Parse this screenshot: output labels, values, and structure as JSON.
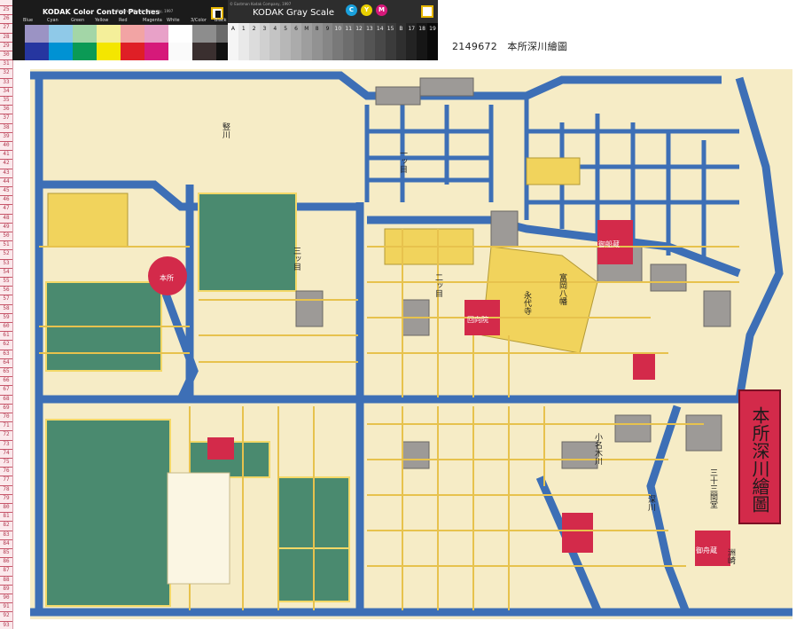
{
  "catalog_label": "2149672　本所深川繪圖",
  "map_title": "本所深川繪圖",
  "ruler": {
    "numbers": [
      "25",
      "26",
      "27",
      "28",
      "29",
      "30",
      "31",
      "32",
      "33",
      "34",
      "35",
      "36",
      "37",
      "38",
      "39",
      "40",
      "41",
      "42",
      "43",
      "44",
      "45",
      "46",
      "47",
      "48",
      "49",
      "50",
      "51",
      "52",
      "53",
      "54",
      "55",
      "56",
      "57",
      "58",
      "59",
      "60",
      "61",
      "62",
      "63",
      "64",
      "65",
      "66",
      "67",
      "68",
      "69",
      "70",
      "71",
      "72",
      "73",
      "74",
      "75",
      "76",
      "77",
      "78",
      "79",
      "80",
      "81",
      "82",
      "83",
      "84",
      "85",
      "86",
      "87",
      "88",
      "89",
      "90",
      "91",
      "92",
      "93"
    ]
  },
  "color_card": {
    "title": "KODAK Color Control Patches",
    "copyright": "© Eastman Kodak Company, 1997",
    "labels": [
      "Blue",
      "Cyan",
      "Green",
      "Yellow",
      "Red",
      "Magenta",
      "White",
      "3/Color",
      "Black"
    ],
    "row1_colors": [
      "#9b93c4",
      "#8fc9e8",
      "#a3d6a7",
      "#f4ef9a",
      "#f2a4a4",
      "#e8a1c8",
      "#ffffff",
      "#8d8d8d",
      "#6a6a6a"
    ],
    "row2_colors": [
      "#2636a0",
      "#0092d3",
      "#0b9a55",
      "#f4e600",
      "#df1f26",
      "#d6197a",
      "#fafafa",
      "#3a2f2f",
      "#111111"
    ]
  },
  "gray_card": {
    "title": "KODAK Gray Scale",
    "copyright": "© Eastman Kodak Company, 1997",
    "dots": [
      "C",
      "Y",
      "M"
    ],
    "steps": [
      "A",
      "1",
      "2",
      "3",
      "4",
      "5",
      "6",
      "M",
      "8",
      "9",
      "10",
      "11",
      "12",
      "13",
      "14",
      "15",
      "B",
      "17",
      "18",
      "19"
    ]
  },
  "map_labels": {
    "labels_red": [
      "本所",
      "回向院",
      "御船蔵",
      "御舟蔵"
    ],
    "block_labels": [
      "一ッ目",
      "二ッ目",
      "三ッ目",
      "竪川",
      "小名木川",
      "深川",
      "富岡八幡",
      "永代寺",
      "三十三間堂",
      "洲崎"
    ]
  }
}
